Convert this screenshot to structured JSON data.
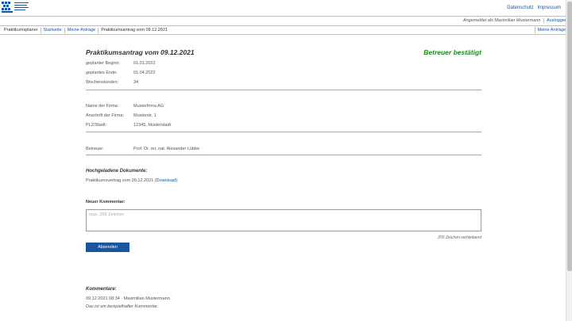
{
  "header": {
    "logo_text": "Fakultät Wirtschaftswissenschaften",
    "privacy": "Datenschutz",
    "imprint": "Impressum"
  },
  "userline": {
    "logged_in": "Angemeldet als Maximilian Mustermann",
    "logout": "Ausloggen"
  },
  "nav": {
    "app": "Praktikumsplaner",
    "home": "Startseite",
    "my_requests": "Meine Anträge",
    "current": "Praktikumsantrag vom 09.12.2021",
    "right": "Meine Anträge"
  },
  "request": {
    "title": "Praktikumsantrag vom 09.12.2021",
    "status": "Betreuer bestätigt",
    "status_color": "#1b8a1b",
    "dates": [
      {
        "label": "geplanter Beginn:",
        "value": "01.01.2022"
      },
      {
        "label": "geplantes Ende:",
        "value": "01.04.2022"
      },
      {
        "label": "Wochenstunden:",
        "value": "34"
      }
    ],
    "company": [
      {
        "label": "Name der Firma:",
        "value": "Musterfirma AG"
      },
      {
        "label": "Anschrift der Firma:",
        "value": "Musterstr. 1"
      },
      {
        "label": "PLZ/Stadt:",
        "value": "12345, Musterstadt"
      }
    ],
    "supervisor": {
      "label": "Betreuer:",
      "value": "Prof. Dr. rer. nat. Alexander Lübbe"
    }
  },
  "documents": {
    "heading": "Hochgeladene Dokumente:",
    "item": "Praktikumsvertrag vom 09.12.2021",
    "download": "(Download)"
  },
  "new_comment": {
    "label": "Neuer Kommentar:",
    "placeholder": "max. 255 Zeichen",
    "chars_left": "255 Zeichen verbleibend",
    "submit": "Absenden"
  },
  "comments": {
    "heading": "Kommentare:",
    "items": [
      {
        "meta": "09.12.2021 08:34 · Maximilian Mustermann",
        "text": "Das ist ein beispielhafter Kommentar."
      }
    ]
  },
  "colors": {
    "accent": "#1a56a0",
    "status_green": "#1b8a1b"
  }
}
